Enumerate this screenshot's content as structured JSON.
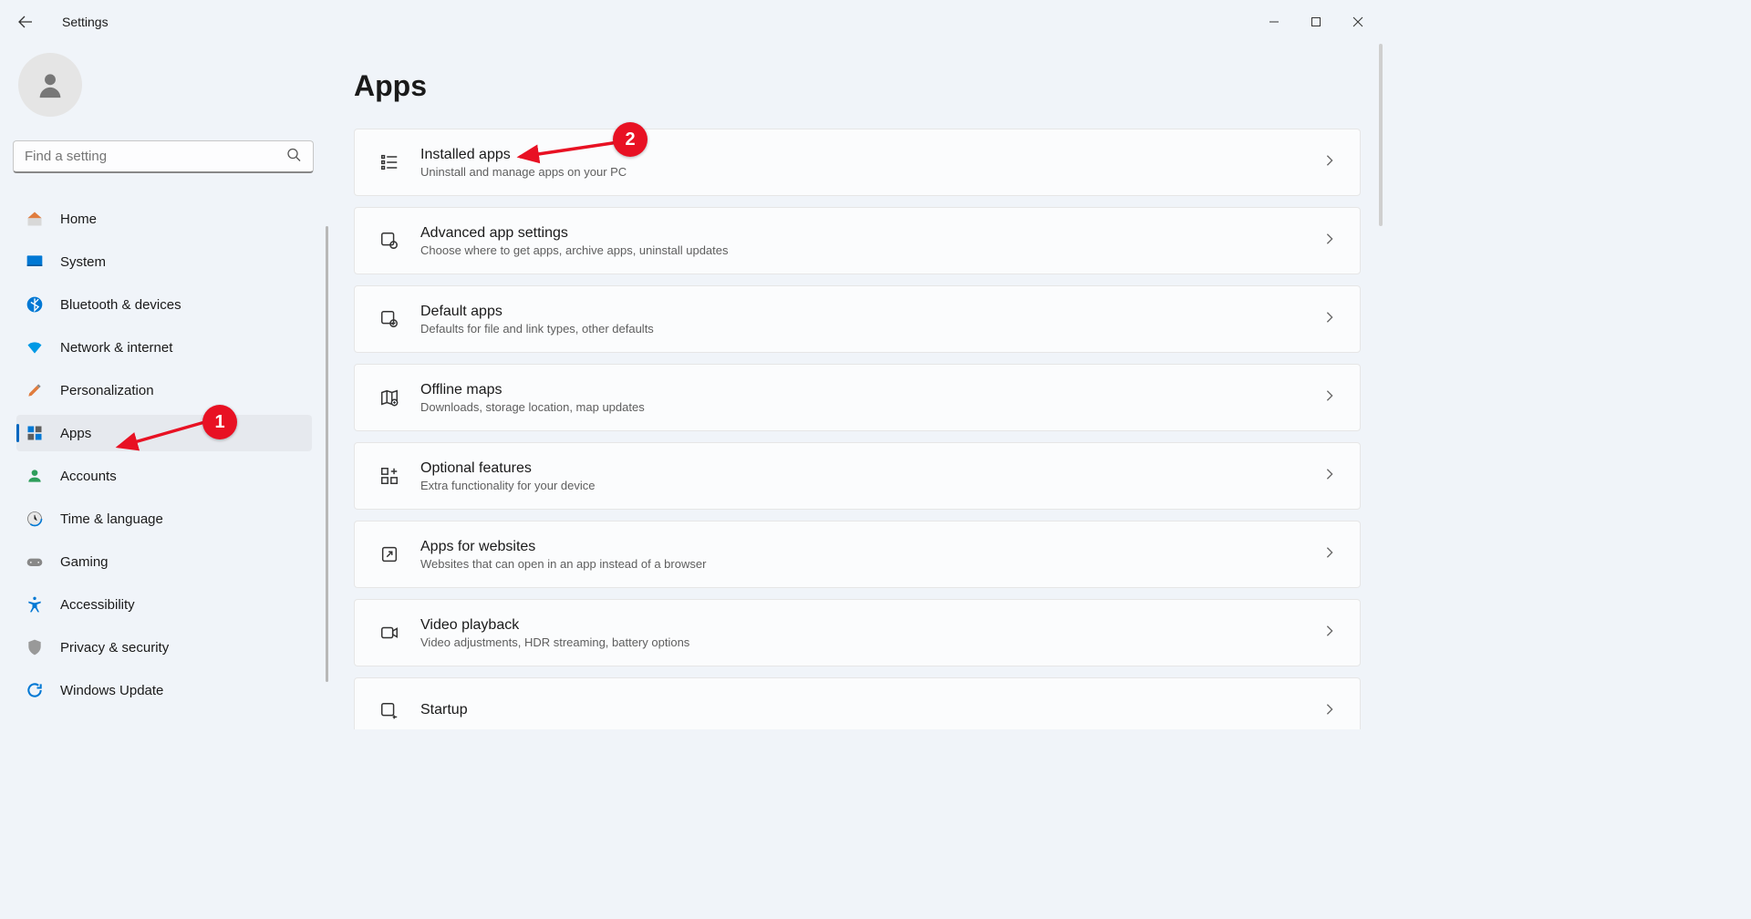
{
  "window": {
    "title": "Settings"
  },
  "search": {
    "placeholder": "Find a setting"
  },
  "sidebar": {
    "items": [
      {
        "label": "Home"
      },
      {
        "label": "System"
      },
      {
        "label": "Bluetooth & devices"
      },
      {
        "label": "Network & internet"
      },
      {
        "label": "Personalization"
      },
      {
        "label": "Apps"
      },
      {
        "label": "Accounts"
      },
      {
        "label": "Time & language"
      },
      {
        "label": "Gaming"
      },
      {
        "label": "Accessibility"
      },
      {
        "label": "Privacy & security"
      },
      {
        "label": "Windows Update"
      }
    ]
  },
  "page": {
    "title": "Apps",
    "cards": [
      {
        "title": "Installed apps",
        "sub": "Uninstall and manage apps on your PC"
      },
      {
        "title": "Advanced app settings",
        "sub": "Choose where to get apps, archive apps, uninstall updates"
      },
      {
        "title": "Default apps",
        "sub": "Defaults for file and link types, other defaults"
      },
      {
        "title": "Offline maps",
        "sub": "Downloads, storage location, map updates"
      },
      {
        "title": "Optional features",
        "sub": "Extra functionality for your device"
      },
      {
        "title": "Apps for websites",
        "sub": "Websites that can open in an app instead of a browser"
      },
      {
        "title": "Video playback",
        "sub": "Video adjustments, HDR streaming, battery options"
      },
      {
        "title": "Startup",
        "sub": ""
      }
    ]
  },
  "annotations": {
    "badge1": "1",
    "badge2": "2"
  }
}
